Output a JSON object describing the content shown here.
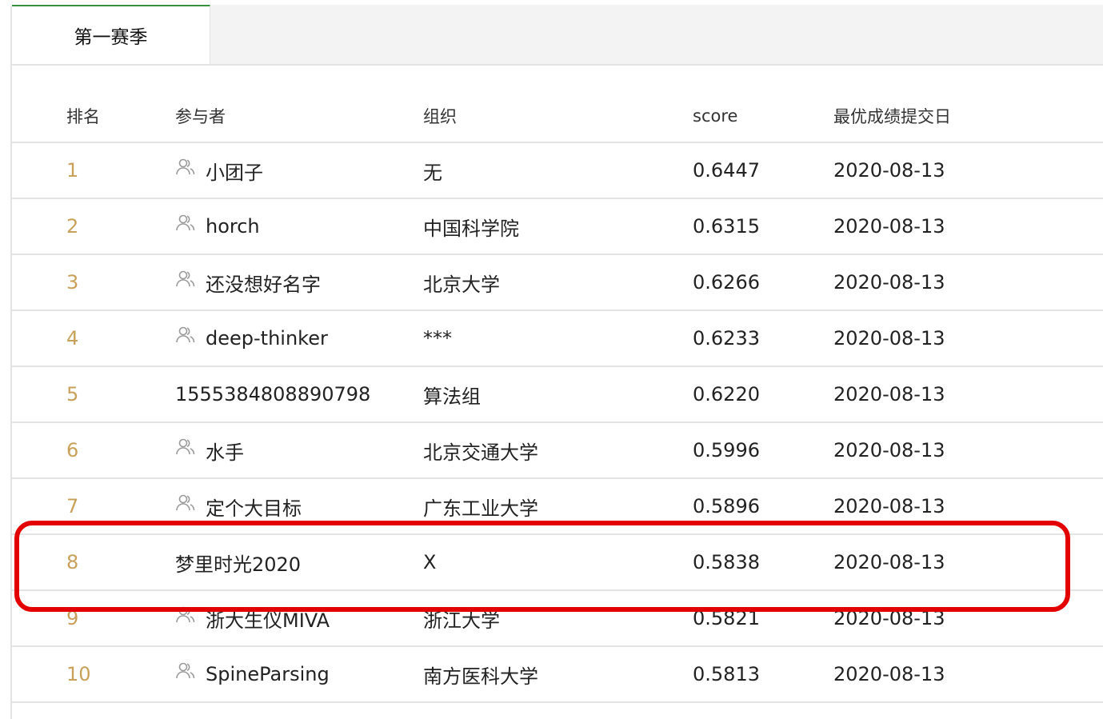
{
  "tabs": [
    {
      "label": "第一赛季"
    }
  ],
  "table": {
    "headers": {
      "rank": "排名",
      "participant": "参与者",
      "organization": "组织",
      "score": "score",
      "best_date": "最优成绩提交日"
    },
    "rows": [
      {
        "rank": "1",
        "participant": "小团子",
        "team_icon": true,
        "organization": "无",
        "score": "0.6447",
        "date": "2020-08-13"
      },
      {
        "rank": "2",
        "participant": "horch",
        "team_icon": true,
        "organization": "中国科学院",
        "score": "0.6315",
        "date": "2020-08-13"
      },
      {
        "rank": "3",
        "participant": "还没想好名字",
        "team_icon": true,
        "organization": "北京大学",
        "score": "0.6266",
        "date": "2020-08-13"
      },
      {
        "rank": "4",
        "participant": "deep-thinker",
        "team_icon": true,
        "organization": "***",
        "score": "0.6233",
        "date": "2020-08-13"
      },
      {
        "rank": "5",
        "participant": "1555384808890798",
        "team_icon": false,
        "organization": "算法组",
        "score": "0.6220",
        "date": "2020-08-13"
      },
      {
        "rank": "6",
        "participant": "水手",
        "team_icon": true,
        "organization": "北京交通大学",
        "score": "0.5996",
        "date": "2020-08-13"
      },
      {
        "rank": "7",
        "participant": "定个大目标",
        "team_icon": true,
        "organization": "广东工业大学",
        "score": "0.5896",
        "date": "2020-08-13"
      },
      {
        "rank": "8",
        "participant": "梦里时光2020",
        "team_icon": false,
        "organization": "X",
        "score": "0.5838",
        "date": "2020-08-13"
      },
      {
        "rank": "9",
        "participant": "浙大生仪MIVA",
        "team_icon": true,
        "organization": "浙江大学",
        "score": "0.5821",
        "date": "2020-08-13"
      },
      {
        "rank": "10",
        "participant": "SpineParsing",
        "team_icon": true,
        "organization": "南方医科大学",
        "score": "0.5813",
        "date": "2020-08-13"
      }
    ]
  },
  "highlight": {
    "row_rank": "8",
    "color": "#e30000"
  },
  "colors": {
    "rank_text": "#c9a05a",
    "tab_accent": "#3a8f3a",
    "border": "#e4e4e4",
    "tabbar_bg": "#f3f3f3"
  },
  "icons": {
    "team": "team-icon"
  }
}
